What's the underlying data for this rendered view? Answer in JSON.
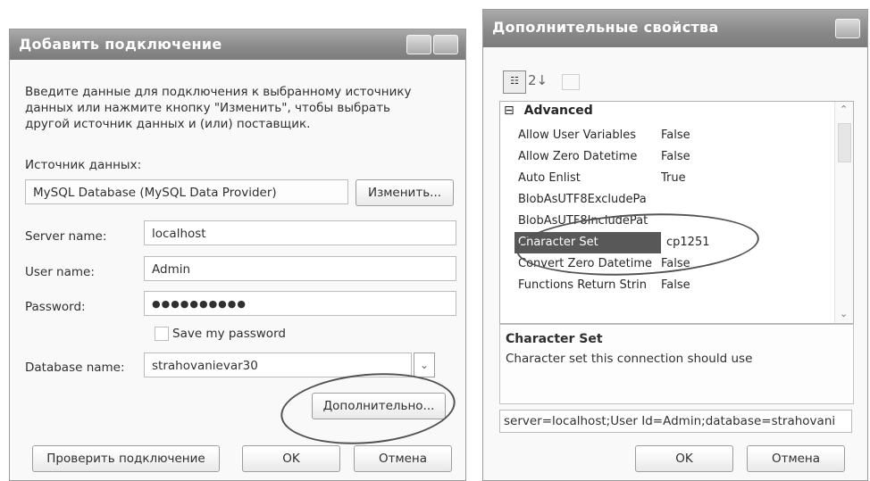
{
  "add_connection": {
    "title": "Добавить подключение",
    "intro_line1": "Введите данные для подключения к выбранному источнику",
    "intro_line2": "данных или нажмите кнопку \"Изменить\", чтобы выбрать",
    "intro_line3": "другой источник данных и (или) поставщик.",
    "datasource_label": "Источник данных:",
    "datasource_value": "MySQL Database (MySQL Data Provider)",
    "change_button": "Изменить...",
    "server_label": "Server name:",
    "server_value": "localhost",
    "user_label": "User name:",
    "user_value": "Admin",
    "password_label": "Password:",
    "password_value": "●●●●●●●●●●",
    "save_password_label": "Save my password",
    "database_label": "Database name:",
    "database_value": "strahovanievar30",
    "advanced_button": "Дополнительно...",
    "test_button": "Проверить подключение",
    "ok_button": "OK",
    "cancel_button": "Отмена"
  },
  "advanced_props": {
    "title": "Дополнительные свойства",
    "category": "Advanced",
    "rows": [
      {
        "name": "Allow User Variables",
        "value": "False"
      },
      {
        "name": "Allow Zero Datetime",
        "value": "False"
      },
      {
        "name": "Auto Enlist",
        "value": "True"
      },
      {
        "name": "BlobAsUTF8ExcludePa",
        "value": ""
      },
      {
        "name": "BlobAsUTF8IncludePat",
        "value": ""
      },
      {
        "name": "Character Set",
        "value": "cp1251"
      },
      {
        "name": "Convert Zero Datetime",
        "value": "False"
      },
      {
        "name": "Functions Return Strin",
        "value": "False"
      }
    ],
    "desc_title": "Character Set",
    "desc_text": "Character set this connection should use",
    "connection_string": "server=localhost;User Id=Admin;database=strahovani",
    "ok_button": "OK",
    "cancel_button": "Отмена"
  }
}
